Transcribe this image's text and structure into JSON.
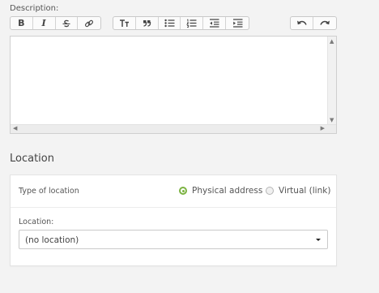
{
  "description": {
    "label": "Description:",
    "toolbar": [
      [
        "bold-button",
        "italic-button",
        "strikethrough-button",
        "link-button"
      ],
      [
        "heading-button",
        "blockquote-button",
        "bulleted-list-button",
        "numbered-list-button",
        "outdent-button",
        "indent-button"
      ],
      [
        "undo-button",
        "redo-button"
      ]
    ],
    "labels": {
      "bold": "B",
      "italic": "I"
    },
    "content": ""
  },
  "location_section": {
    "title": "Location",
    "type_label": "Type of location",
    "options": [
      {
        "label": "Physical address",
        "selected": true
      },
      {
        "label": "Virtual (link)",
        "selected": false
      }
    ],
    "location_label": "Location:",
    "location_value": "(no location)"
  },
  "colors": {
    "accent": "#7cb342"
  }
}
